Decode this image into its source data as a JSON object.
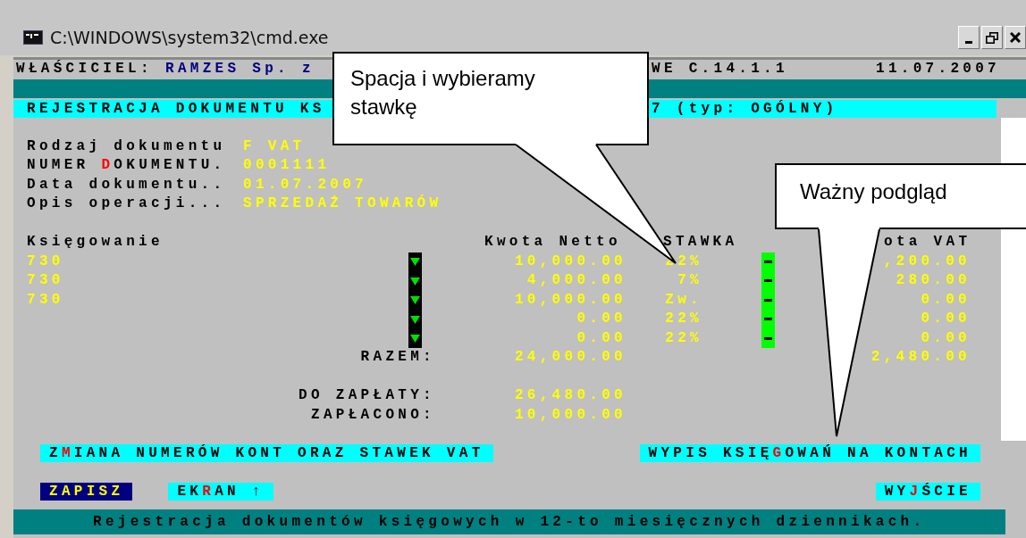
{
  "window": {
    "title": "C:\\WINDOWS\\system32\\cmd.exe"
  },
  "header": {
    "owner_label": "WŁAŚCICIEL:",
    "owner": "RAMZES Sp. z",
    "version": "WE C.14.1.1",
    "date": "11.07.2007"
  },
  "screen_title": {
    "left": "REJESTRACJA DOKUMENTU KS",
    "right": "7 (typ: OGÓLNY)"
  },
  "fields": [
    {
      "label_before": "Rodzaj dokumentu",
      "value": "F VAT"
    },
    {
      "label_before": "NUMER ",
      "hotkey": "D",
      "label_after": "OKUMENTU.",
      "value": "0001111"
    },
    {
      "label_before": "Data dokumentu..",
      "value": "01.07.2007"
    },
    {
      "label_before": "Opis operacji...",
      "value": "SPRZEDAŻ TOWARÓW"
    }
  ],
  "table": {
    "columns": [
      "Księgowanie",
      "Kwota Netto",
      "STAWKA",
      "ota VAT"
    ],
    "rows": [
      {
        "account": "730",
        "net": "10,000.00",
        "rate": "22%",
        "vat": ",200.00"
      },
      {
        "account": "730",
        "net": "4,000.00",
        "rate": "7%",
        "vat": "280.00"
      },
      {
        "account": "730",
        "net": "10,000.00",
        "rate": "Zw.",
        "vat": "0.00"
      },
      {
        "net": "0.00",
        "rate": "22%",
        "vat": "0.00"
      },
      {
        "net": "0.00",
        "rate": "22%",
        "vat": "0.00"
      }
    ],
    "total": {
      "label": "RAZEM:",
      "net": "24,000.00",
      "vat": "2,480.00"
    }
  },
  "payment": [
    {
      "label": "DO ZAPŁATY:",
      "value": "26,480.00"
    },
    {
      "label": "ZAPŁACONO:",
      "value": "10,000.00"
    }
  ],
  "action_rows": [
    {
      "left": [
        {
          "before": "Z",
          "hotkey": "M",
          "after": "IANA NUMERÓW KONT ORAZ STAWEK VAT",
          "selected": false
        }
      ],
      "right": [
        {
          "before": "WYPIS KSIĘ",
          "hotkey": "G",
          "after": "OWAŃ NA KONTACH",
          "selected": false
        }
      ]
    },
    {
      "left": [
        {
          "before": "ZAPISZ",
          "selected": true
        },
        {
          "before": "EK",
          "hotkey": "R",
          "after": "AN ↑",
          "selected": false
        }
      ],
      "right": [
        {
          "before": "WY",
          "hotkey": "J",
          "after": "ŚCIE",
          "selected": false
        }
      ]
    }
  ],
  "status_bar": "Rejestracja dokumentów księgowych w 12-to miesięcznych dziennikach.",
  "callouts": [
    {
      "text": "Spacja i wybieramy stawkę"
    },
    {
      "text": "Ważny podgląd"
    }
  ]
}
